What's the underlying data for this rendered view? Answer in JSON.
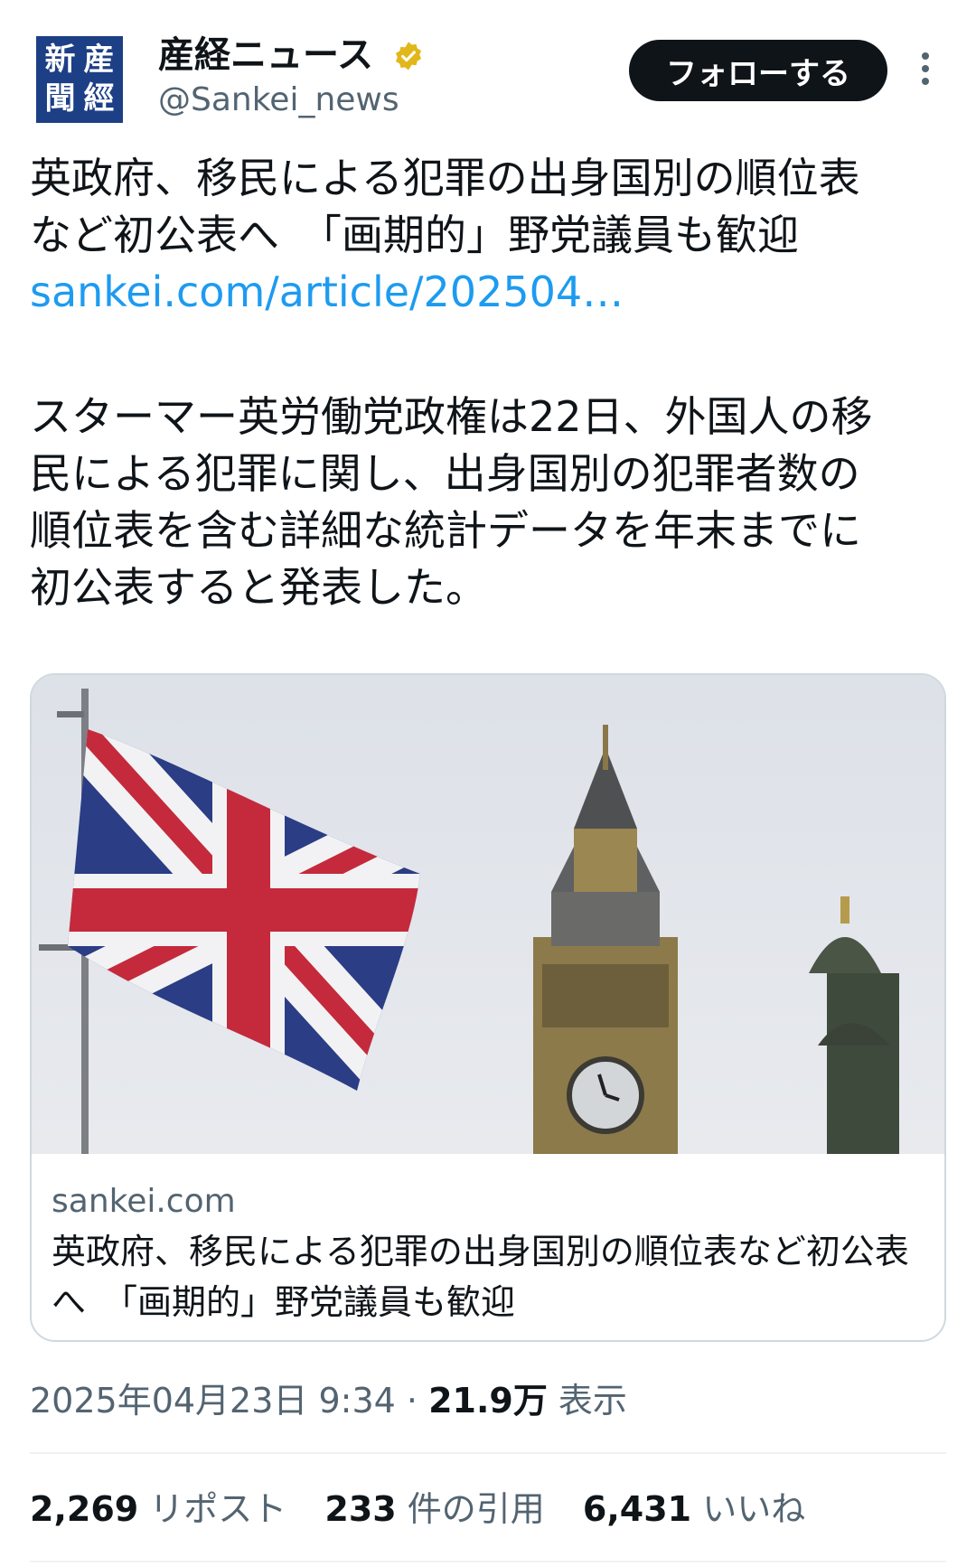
{
  "account": {
    "name": "産経ニュース",
    "handle": "@Sankei_news",
    "logo_chars": [
      "新",
      "産",
      "聞",
      "經"
    ],
    "follow_label": "フォローする",
    "badge_color": "#e2b719"
  },
  "tweet": {
    "headline_lines": [
      "英政府、移民による犯罪の出身国別の順位表",
      "など初公表へ　「画期的」野党議員も歓迎"
    ],
    "link": "sankei.com/article/202504…",
    "body_lines": [
      "スターマー英労働党政権は22日、外国人の移",
      "民による犯罪に関し、出身国別の犯罪者数の",
      "順位表を含む詳細な統計データを年末までに",
      "初公表すると発表した。"
    ]
  },
  "card": {
    "domain": "sankei.com",
    "title": "英政府、移民による犯罪の出身国別の順位表など初公表へ　「画期的」野党議員も歓迎",
    "image_icon": "union-jack-big-ben-photo"
  },
  "meta": {
    "time": "2025年04月23日 9:34 · ",
    "views": "21.9万",
    "views_label": " 表示"
  },
  "stats": {
    "reposts": "2,269",
    "reposts_label": " リポスト",
    "quotes": "233",
    "quotes_label": " 件の引用",
    "likes": "6,431",
    "likes_label": " いいね"
  }
}
